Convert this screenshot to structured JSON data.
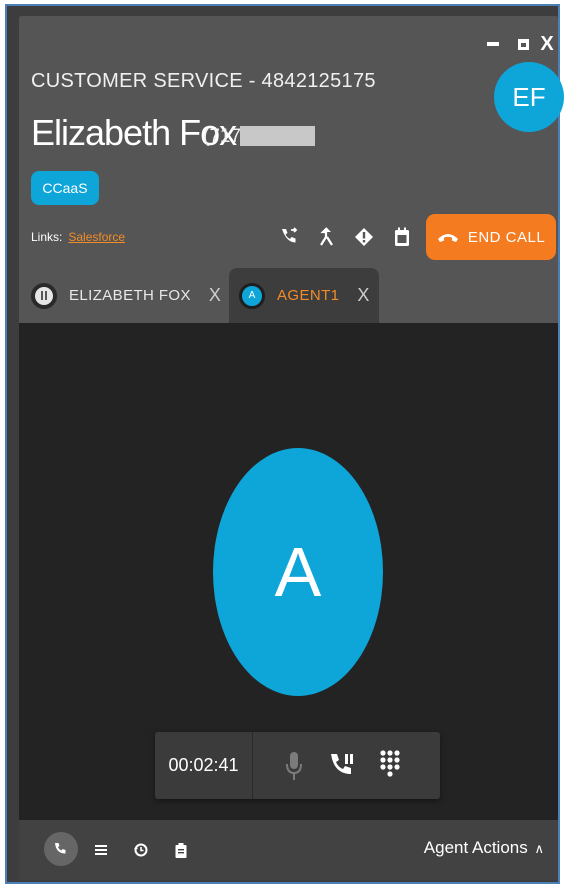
{
  "window": {
    "controls": [
      "minimize",
      "maximize",
      "close"
    ],
    "close_label": "X"
  },
  "header": {
    "queue": "CUSTOMER SERVICE - 4842125175",
    "customer_name": "Elizabeth Fox",
    "phone_partial": "(717",
    "avatar_initials": "EF",
    "tag": "CCaaS",
    "links_label": "Links:",
    "links": [
      "Salesforce"
    ]
  },
  "toolbar": {
    "icons": [
      "transfer-call-icon",
      "merge-icon",
      "alert-icon",
      "calendar-icon"
    ],
    "end_call_label": "END CALL"
  },
  "tabs": [
    {
      "label": "ELIZABETH FOX",
      "avatar": "pause",
      "close": "X",
      "active": false
    },
    {
      "label": "AGENT1",
      "avatar": "A",
      "close": "X",
      "active": true
    }
  ],
  "main": {
    "avatar_letter": "A"
  },
  "call_controls": {
    "timer": "00:02:41",
    "buttons": [
      "microphone-icon",
      "hold-icon",
      "dialpad-icon"
    ]
  },
  "footer": {
    "buttons": [
      "phone-icon",
      "list-icon",
      "history-icon",
      "clipboard-icon"
    ],
    "agent_actions_label": "Agent Actions"
  },
  "colors": {
    "accent": "#0ea5d8",
    "end_call": "#f47b20",
    "link": "#f28c28",
    "header_bg": "#555555",
    "body_bg": "#232323"
  }
}
